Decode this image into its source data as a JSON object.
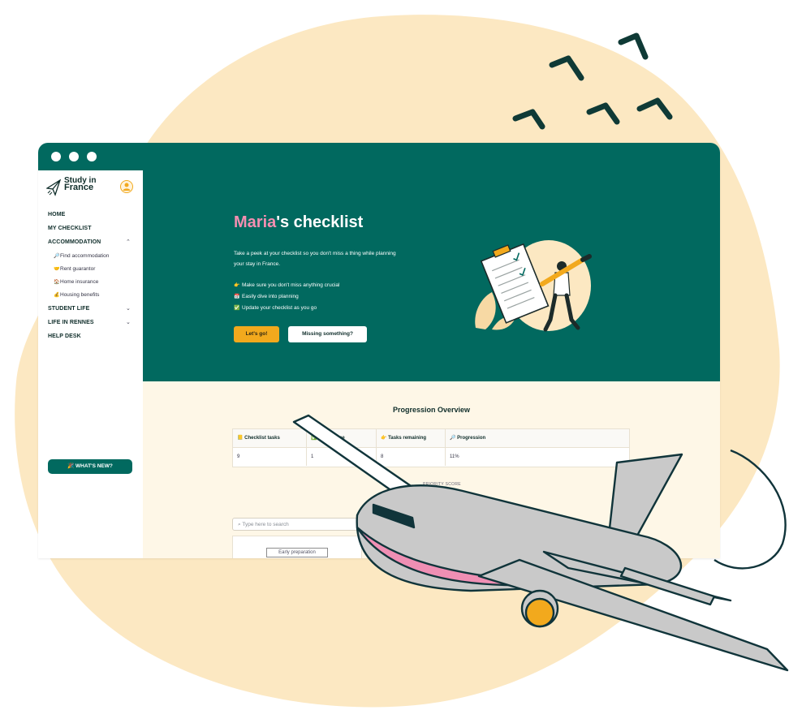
{
  "colors": {
    "brand_green": "#01695f",
    "accent_orange": "#f2a91d",
    "name_pink": "#f48fb1",
    "cream": "#fef7e7",
    "blob": "#fce8c2"
  },
  "sidebar": {
    "logo_line1": "Study in",
    "logo_line2": "France",
    "items": [
      {
        "label": "HOME"
      },
      {
        "label": "MY CHECKLIST"
      },
      {
        "label": "ACCOMMODATION",
        "expanded": true,
        "children": [
          {
            "icon": "magnifier-icon",
            "label": "Find accommodation"
          },
          {
            "icon": "handshake-icon",
            "label": "Rent guarantor"
          },
          {
            "icon": "house-icon",
            "label": "Home insurance"
          },
          {
            "icon": "money-bag-icon",
            "label": "Housing benefits"
          }
        ]
      },
      {
        "label": "STUDENT LIFE"
      },
      {
        "label": "LIFE IN RENNES"
      },
      {
        "label": "HELP DESK"
      }
    ],
    "whats_new": "WHAT'S NEW?"
  },
  "hero": {
    "name": "Maria",
    "title_suffix": "'s checklist",
    "description": "Take a peek at your checklist so you don't miss a thing while planning your stay in France.",
    "bullets": [
      {
        "icon": "pointing-hand-icon",
        "text": "Make sure you don't miss anything crucial"
      },
      {
        "icon": "calendar-icon",
        "text": "Easily dive into planning"
      },
      {
        "icon": "check-box-icon",
        "text": "Update your checklist as you go"
      }
    ],
    "primary_button": "Let's go!",
    "secondary_button": "Missing something?"
  },
  "overview": {
    "title": "Progression Overview",
    "columns": [
      "Checklist tasks",
      "Tasks done",
      "Tasks remaining",
      "Progression"
    ],
    "values": [
      "9",
      "1",
      "8",
      "11%"
    ],
    "score_label": "PRIORITY SCORE"
  },
  "search": {
    "placeholder": "Type here to search"
  },
  "card": {
    "tag": "Early preparation"
  }
}
